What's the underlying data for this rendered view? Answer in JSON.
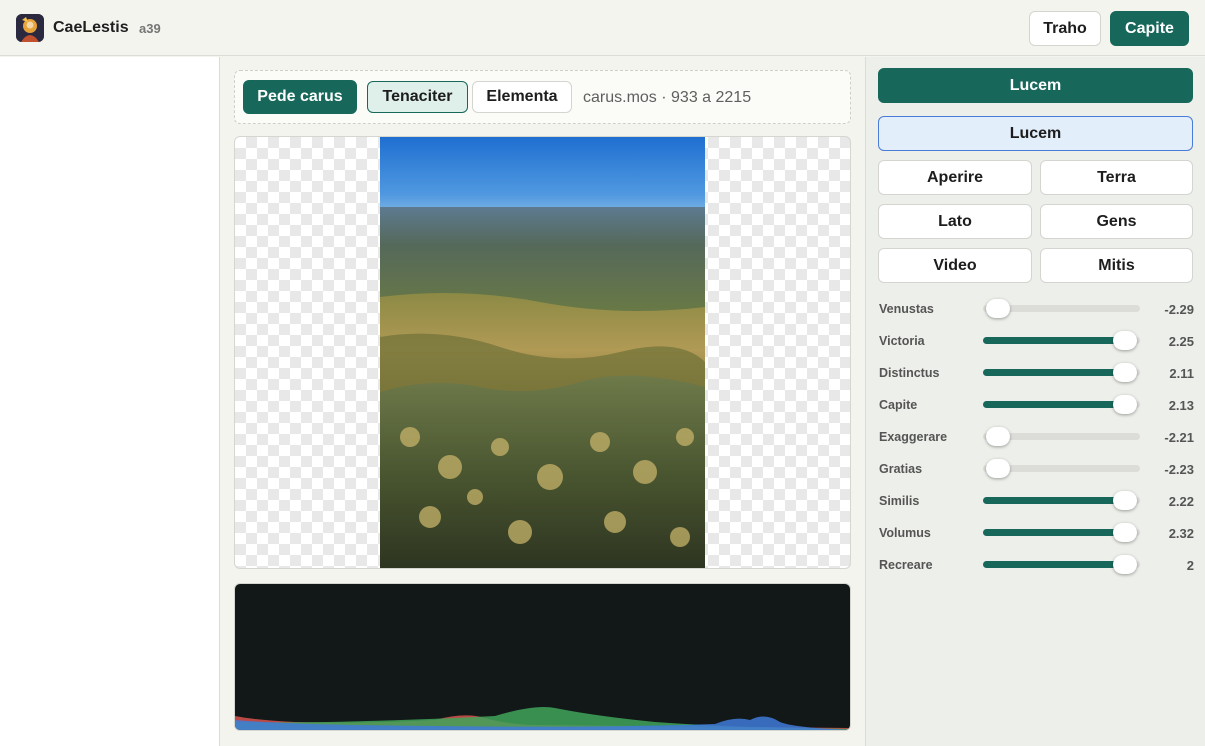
{
  "header": {
    "app_name": "CaeLestis",
    "version": "a39",
    "secondary_button": "Traho",
    "primary_button": "Capite"
  },
  "toolbar": {
    "primary_button": "Pede carus",
    "tab_active": "Tenaciter",
    "tab_other": "Elementa",
    "file_info": "carus.mos · 933 a 2215"
  },
  "panel": {
    "main_button": "Lucem",
    "selected_button": "Lucem",
    "options": [
      "Aperire",
      "Terra",
      "Lato",
      "Gens",
      "Video",
      "Mitis"
    ]
  },
  "sliders": [
    {
      "label": "Venustas",
      "value": "-2.29",
      "level": 0.02
    },
    {
      "label": "Victoria",
      "value": "2.25",
      "level": 0.98
    },
    {
      "label": "Distinctus",
      "value": "2.11",
      "level": 0.98
    },
    {
      "label": "Capite",
      "value": "2.13",
      "level": 0.98
    },
    {
      "label": "Exaggerare",
      "value": "-2.21",
      "level": 0.02
    },
    {
      "label": "Gratias",
      "value": "-2.23",
      "level": 0.02
    },
    {
      "label": "Similis",
      "value": "2.22",
      "level": 0.98
    },
    {
      "label": "Volumus",
      "value": "2.32",
      "level": 0.98
    },
    {
      "label": "Recreare",
      "value": "2",
      "level": 0.98
    }
  ],
  "colors": {
    "accent": "#17685b",
    "histogram_red": "#d9534f",
    "histogram_green": "#3fa45a",
    "histogram_blue": "#3f7ad8"
  }
}
